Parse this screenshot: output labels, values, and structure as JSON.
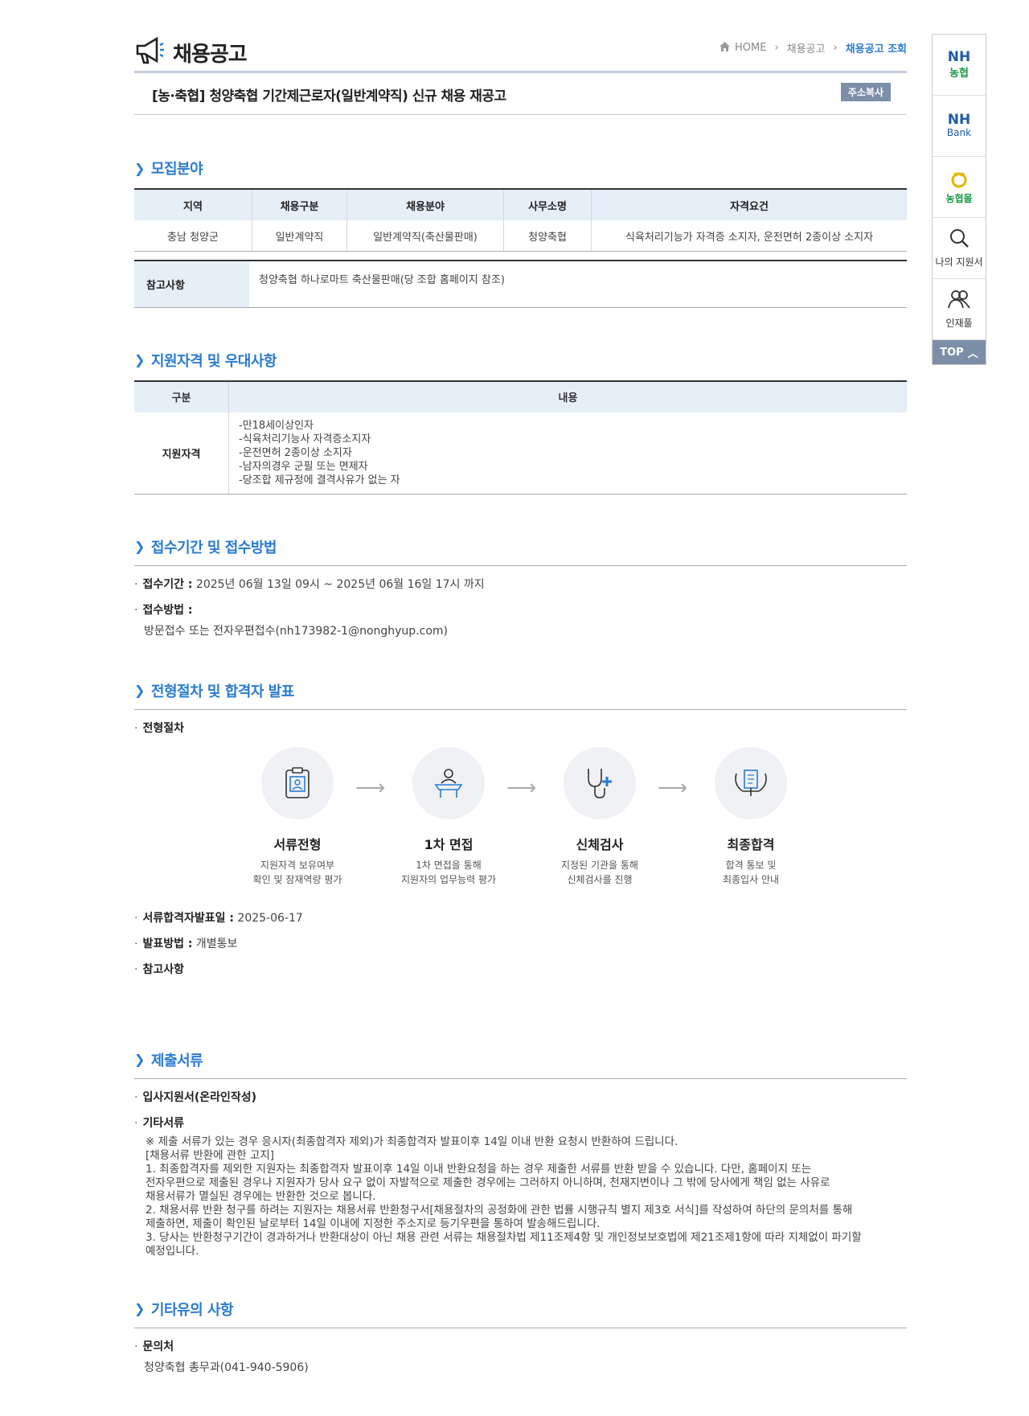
{
  "header": {
    "title": "채용공고",
    "breadcrumb": [
      "HOME",
      "채용공고",
      "채용공고 조회"
    ]
  },
  "post": {
    "title": "[농·축협] 청양축협 기간제근로자(일반계약직) 신규 채용 재공고",
    "copy_label": "주소복사"
  },
  "recruit": {
    "section_title": "모집분야",
    "columns": [
      "지역",
      "채용구분",
      "채용분야",
      "사무소명",
      "자격요건"
    ],
    "row": [
      "충남 청양군",
      "일반계약직",
      "일반계약직(축산물판매)",
      "청양축협",
      "식육처리기능가 자격증 소지자, 운전면허 2종이상 소지자"
    ],
    "note_label": "참고사항",
    "note_text": "청양축협 하나로마트 축산물판매(당 조합 홈페이지 참조)"
  },
  "qual": {
    "section_title": "지원자격 및 우대사항",
    "columns": [
      "구분",
      "내용"
    ],
    "label": "지원자격",
    "lines": [
      "-만18세이상인자",
      "-식육처리기능사 자격증소지자",
      "-운전면허 2종이상 소지자",
      "-남자의경우 군필 또는 면제자",
      "-당조합 제규정에 결격사유가 없는 자"
    ]
  },
  "apply": {
    "section_title": "접수기간 및 접수방법",
    "period_label": "접수기간 :",
    "period_value": "2025년 06월 13일 09시 ~ 2025년 06월 16일 17시 까지",
    "method_label": "접수방법 :",
    "method_value": "방문접수 또는 전자우편접수(nh173982-1@nonghyup.com)"
  },
  "process": {
    "section_title": "전형절차 및 합격자 발표",
    "subtitle": "전형절차",
    "steps": [
      {
        "title": "서류전형",
        "d1": "지원자격 보유여부",
        "d2": "확인 및 잠재역량 평가"
      },
      {
        "title": "1차 면접",
        "d1": "1차 면접을 통해",
        "d2": "지원자의 업무능력 평가"
      },
      {
        "title": "신체검사",
        "d1": "지정된 기관을 통해",
        "d2": "신체검사를 진행"
      },
      {
        "title": "최종합격",
        "d1": "합격 통보 및",
        "d2": "최종입사 안내"
      }
    ],
    "date_label": "서류합격자발표일 :",
    "date_value": "2025-06-17",
    "announce_label": "발표방법 :",
    "announce_value": "개별통보",
    "note_label": "참고사항"
  },
  "docs": {
    "section_title": "제출서류",
    "item1": "입사지원서(온라인작성)",
    "item2": "기타서류",
    "lines": [
      "※ 제출 서류가 있는 경우 응시자(최종합격자 제외)가 최종합격자 발표이후 14일 이내 반환 요청시 반환하여 드립니다.",
      "[채용서류 반환에 관한 고지]",
      " 1. 최종합격자를 제외한 지원자는 최종합격자 발표이후 14일 이내 반환요청을 하는 경우 제출한 서류를 반환 받을 수 있습니다. 다만, 홈페이지 또는",
      "전자우편으로 제출된 경우나 지원자가 당사 요구 없이 자발적으로 제출한 경우에는 그러하지 아니하며, 천재지변이나 그 밖에 당사에게 책임 없는 사유로",
      "채용서류가 멸실된 경우에는 반환한 것으로 봅니다.",
      " 2. 채용서류 반환 청구를 하려는 지원자는 채용서류 반환청구서[채용절차의 공정화에 관한 법률 시행규칙 별지 제3호 서식]를 작성하여 하단의 문의처를 통해",
      "제출하면, 제출이 확인된 날로부터 14일 이내에 지정한 주소지로 등기우편을 통하여 발송해드립니다.",
      " 3. 당사는 반환청구기간이 경과하거나 반환대상이 아닌 채용 관련 서류는 채용절차법 제11조제4항 및 개인정보보호법에 제21조제1항에 따라 지체없이 파기할",
      "예정입니다."
    ]
  },
  "etc": {
    "section_title": "기타유의 사항",
    "contact_label": "문의처",
    "contact_value": "청양축협 총무과(041-940-5906)"
  },
  "sidebar": {
    "nh_top": "NH",
    "nh_bottom": "농협",
    "bank_top": "NH",
    "bank_bottom": "Bank",
    "mall": "농협몰",
    "my": "나의 지원서",
    "pool": "인재풀",
    "top": "TOP"
  },
  "colors": {
    "accent": "#2a7bd0",
    "header_bg": "#e6eef8",
    "button": "#7d8ea9"
  }
}
